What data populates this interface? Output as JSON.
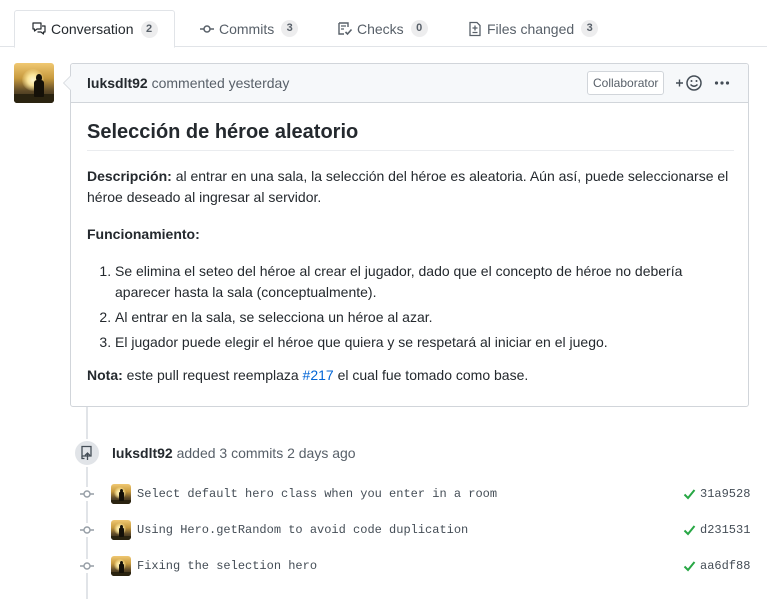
{
  "tabs": [
    {
      "label": "Conversation",
      "count": "2",
      "icon": "comment-discussion-icon"
    },
    {
      "label": "Commits",
      "count": "3",
      "icon": "git-commit-icon"
    },
    {
      "label": "Checks",
      "count": "0",
      "icon": "checklist-icon"
    },
    {
      "label": "Files changed",
      "count": "3",
      "icon": "file-diff-icon"
    }
  ],
  "comment": {
    "author": "luksdlt92",
    "action": "commented yesterday",
    "role_badge": "Collaborator",
    "reaction_icon": "smiley-icon",
    "more_icon": "kebab-horizontal-icon",
    "title": "Selección de héroe aleatorio",
    "description_label": "Descripción:",
    "description_text": " al entrar en una sala, la selección del héroe es aleatoria. Aún así, puede seleccionarse el héroe deseado al ingresar al servidor.",
    "funcionamiento_label": "Funcionamiento:",
    "steps": [
      "Se elimina el seteo del héroe al crear el jugador, dado que el concepto de héroe no debería aparecer hasta la sala (conceptualmente).",
      "Al entrar en la sala, se selecciona un héroe al azar.",
      "El jugador puede elegir el héroe que quiera y se respetará al iniciar en el juego."
    ],
    "nota_label": "Nota:",
    "nota_before": " este pull request reemplaza ",
    "nota_link": "#217",
    "nota_after": " el cual fue tomado como base."
  },
  "commits_event": {
    "author": "luksdlt92",
    "action": "added 3 commits 2 days ago",
    "icon": "repo-push-icon",
    "commits": [
      {
        "message": "Select default hero class when you enter in a room",
        "sha": "31a9528",
        "status": "success"
      },
      {
        "message": "Using Hero.getRandom to avoid code duplication",
        "sha": "d231531",
        "status": "success"
      },
      {
        "message": "Fixing the selection hero",
        "sha": "aa6df88",
        "status": "success"
      }
    ]
  },
  "colors": {
    "link": "#0366d6",
    "success": "#28a745",
    "border": "#d1d5da",
    "header_bg": "#f6f8fa"
  }
}
